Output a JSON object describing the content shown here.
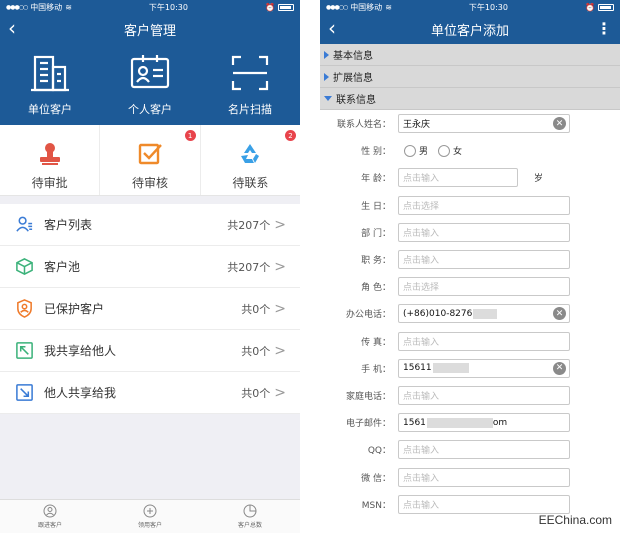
{
  "left": {
    "status": {
      "carrier": "中国移动",
      "time": "下午10:30"
    },
    "title": "客户管理",
    "top_menu": [
      {
        "label": "单位客户",
        "icon": "building-icon"
      },
      {
        "label": "个人客户",
        "icon": "id-card-icon"
      },
      {
        "label": "名片扫描",
        "icon": "scan-icon"
      }
    ],
    "tasks": [
      {
        "label": "待审批",
        "icon": "stamp-icon",
        "badge": ""
      },
      {
        "label": "待审核",
        "icon": "checkbox-icon",
        "badge": "1"
      },
      {
        "label": "待联系",
        "icon": "recycle-icon",
        "badge": "2"
      }
    ],
    "list": [
      {
        "label": "客户列表",
        "count": "共207个",
        "icon": "users-icon"
      },
      {
        "label": "客户池",
        "count": "共207个",
        "icon": "cube-icon"
      },
      {
        "label": "已保护客户",
        "count": "共0个",
        "icon": "shield-user-icon"
      },
      {
        "label": "我共享给他人",
        "count": "共0个",
        "icon": "share-out-icon"
      },
      {
        "label": "他人共享给我",
        "count": "共0个",
        "icon": "share-in-icon"
      }
    ],
    "tabbar": [
      {
        "label": "跟进客户",
        "icon": "follow-icon"
      },
      {
        "label": "领用客户",
        "icon": "claim-icon"
      },
      {
        "label": "客户总数",
        "icon": "total-icon"
      }
    ]
  },
  "right": {
    "status": {
      "carrier": "中国移动",
      "time": "下午10:30"
    },
    "title": "单位客户添加",
    "sections": {
      "basic": "基本信息",
      "extended": "扩展信息",
      "contact": "联系信息"
    },
    "form": {
      "name": {
        "label": "联系人姓名：",
        "value": "王永庆"
      },
      "gender": {
        "label": "性  别：",
        "male": "男",
        "female": "女"
      },
      "age": {
        "label": "年  龄：",
        "placeholder": "点击输入",
        "unit": "岁"
      },
      "birthday": {
        "label": "生  日：",
        "placeholder": "点击选择"
      },
      "department": {
        "label": "部  门：",
        "placeholder": "点击输入"
      },
      "position": {
        "label": "职  务：",
        "placeholder": "点击输入"
      },
      "role": {
        "label": "角  色：",
        "placeholder": "点击选择"
      },
      "office_phone": {
        "label": "办公电话：",
        "value": "(+86)010-8276"
      },
      "fax": {
        "label": "传  真：",
        "placeholder": "点击输入"
      },
      "mobile": {
        "label": "手  机：",
        "value": "15611"
      },
      "home_phone": {
        "label": "家庭电话：",
        "placeholder": "点击输入"
      },
      "email": {
        "label": "电子邮件：",
        "value_prefix": "1561",
        "value_suffix": "om"
      },
      "qq": {
        "label": "QQ：",
        "placeholder": "点击输入"
      },
      "wechat": {
        "label": "微  信：",
        "placeholder": "点击输入"
      },
      "msn": {
        "label": "MSN：",
        "placeholder": "点击输入"
      }
    }
  },
  "watermark": "EEChina.com",
  "colors": {
    "primary": "#1d5a97",
    "badge": "#e8434b",
    "accent": "#3a7bd5"
  }
}
